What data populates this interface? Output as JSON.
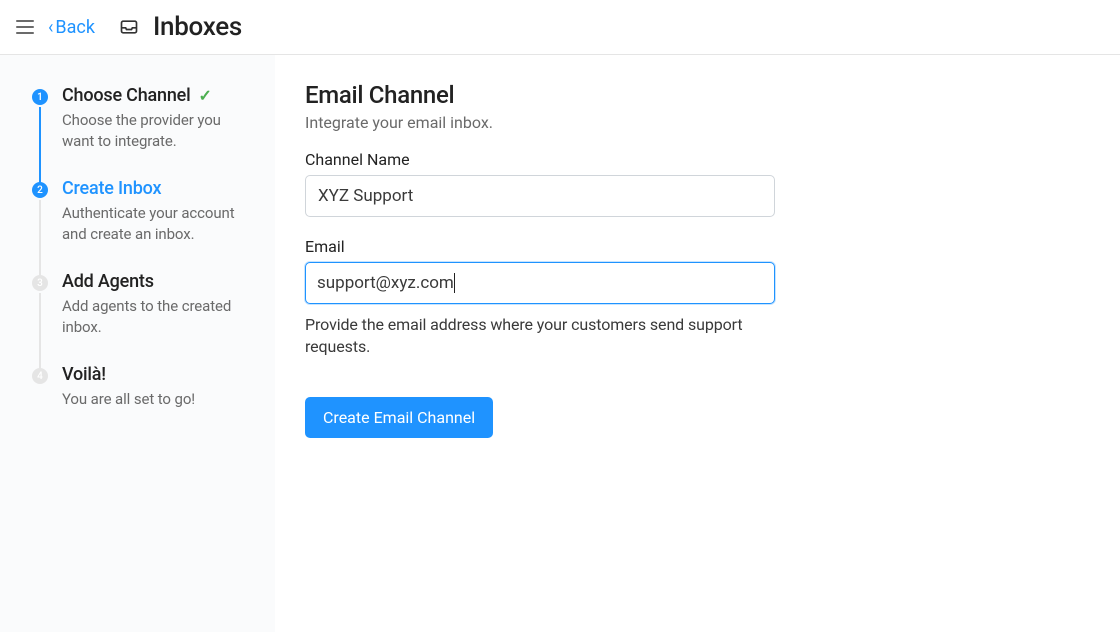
{
  "header": {
    "back_label": "Back",
    "page_title": "Inboxes"
  },
  "steps": [
    {
      "num": "1",
      "title": "Choose Channel",
      "desc": "Choose the provider you want to integrate.",
      "done": true
    },
    {
      "num": "2",
      "title": "Create Inbox",
      "desc": "Authenticate your account and create an inbox.",
      "active": true
    },
    {
      "num": "3",
      "title": "Add Agents",
      "desc": "Add agents to the created inbox."
    },
    {
      "num": "4",
      "title": "Voilà!",
      "desc": "You are all set to go!"
    }
  ],
  "form": {
    "heading": "Email Channel",
    "subheading": "Integrate your email inbox.",
    "channel_name_label": "Channel Name",
    "channel_name_value": "XYZ Support",
    "email_label": "Email",
    "email_value": "support@xyz.com",
    "email_help": "Provide the email address where your customers send support requests.",
    "submit_label": "Create Email Channel"
  }
}
